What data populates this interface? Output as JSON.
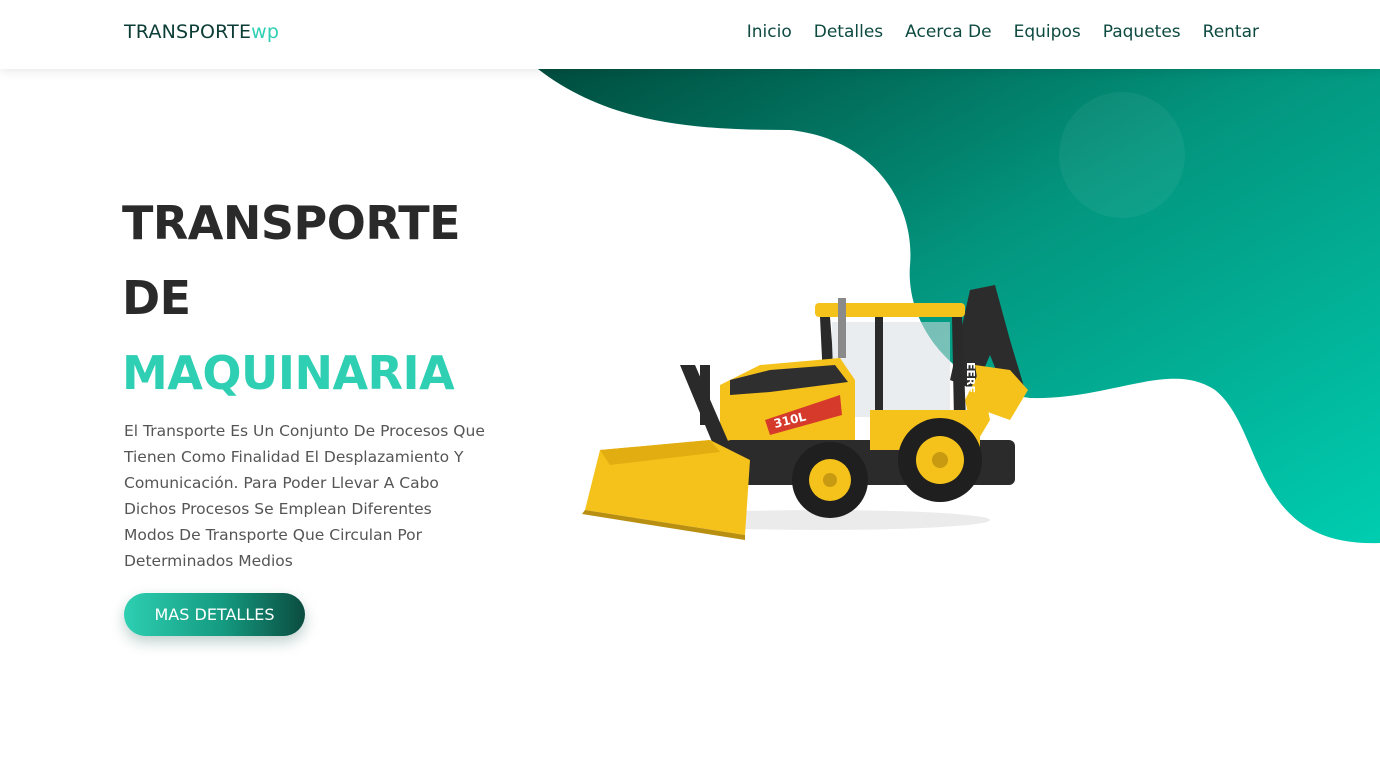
{
  "header": {
    "logo_main": "TRANSPORTE",
    "logo_accent": "wp",
    "nav": [
      {
        "label": "Inicio"
      },
      {
        "label": "Detalles"
      },
      {
        "label": "Acerca De"
      },
      {
        "label": "Equipos"
      },
      {
        "label": "Paquetes"
      },
      {
        "label": "Rentar"
      }
    ]
  },
  "hero": {
    "title_line1": "TRANSPORTE",
    "title_line2": "DE",
    "title_line3": "MAQUINARIA",
    "description": "El Transporte Es Un Conjunto De Procesos Que Tienen Como Finalidad El Desplazamiento Y Comunicación. Para Poder Llevar A Cabo Dichos Procesos Se Emplean Diferentes Modos De Transporte Que Circulan Por Determinados Medios",
    "cta_label": "MAS DETALLES",
    "machine_model": "310L",
    "machine_brand": "EERE"
  },
  "colors": {
    "accent": "#2ecfb2",
    "dark_green": "#0b4c3f",
    "text_dark": "#2a2a2a",
    "machine_yellow": "#f5c21b"
  },
  "icons": {
    "machine": "backhoe-loader-illustration"
  }
}
